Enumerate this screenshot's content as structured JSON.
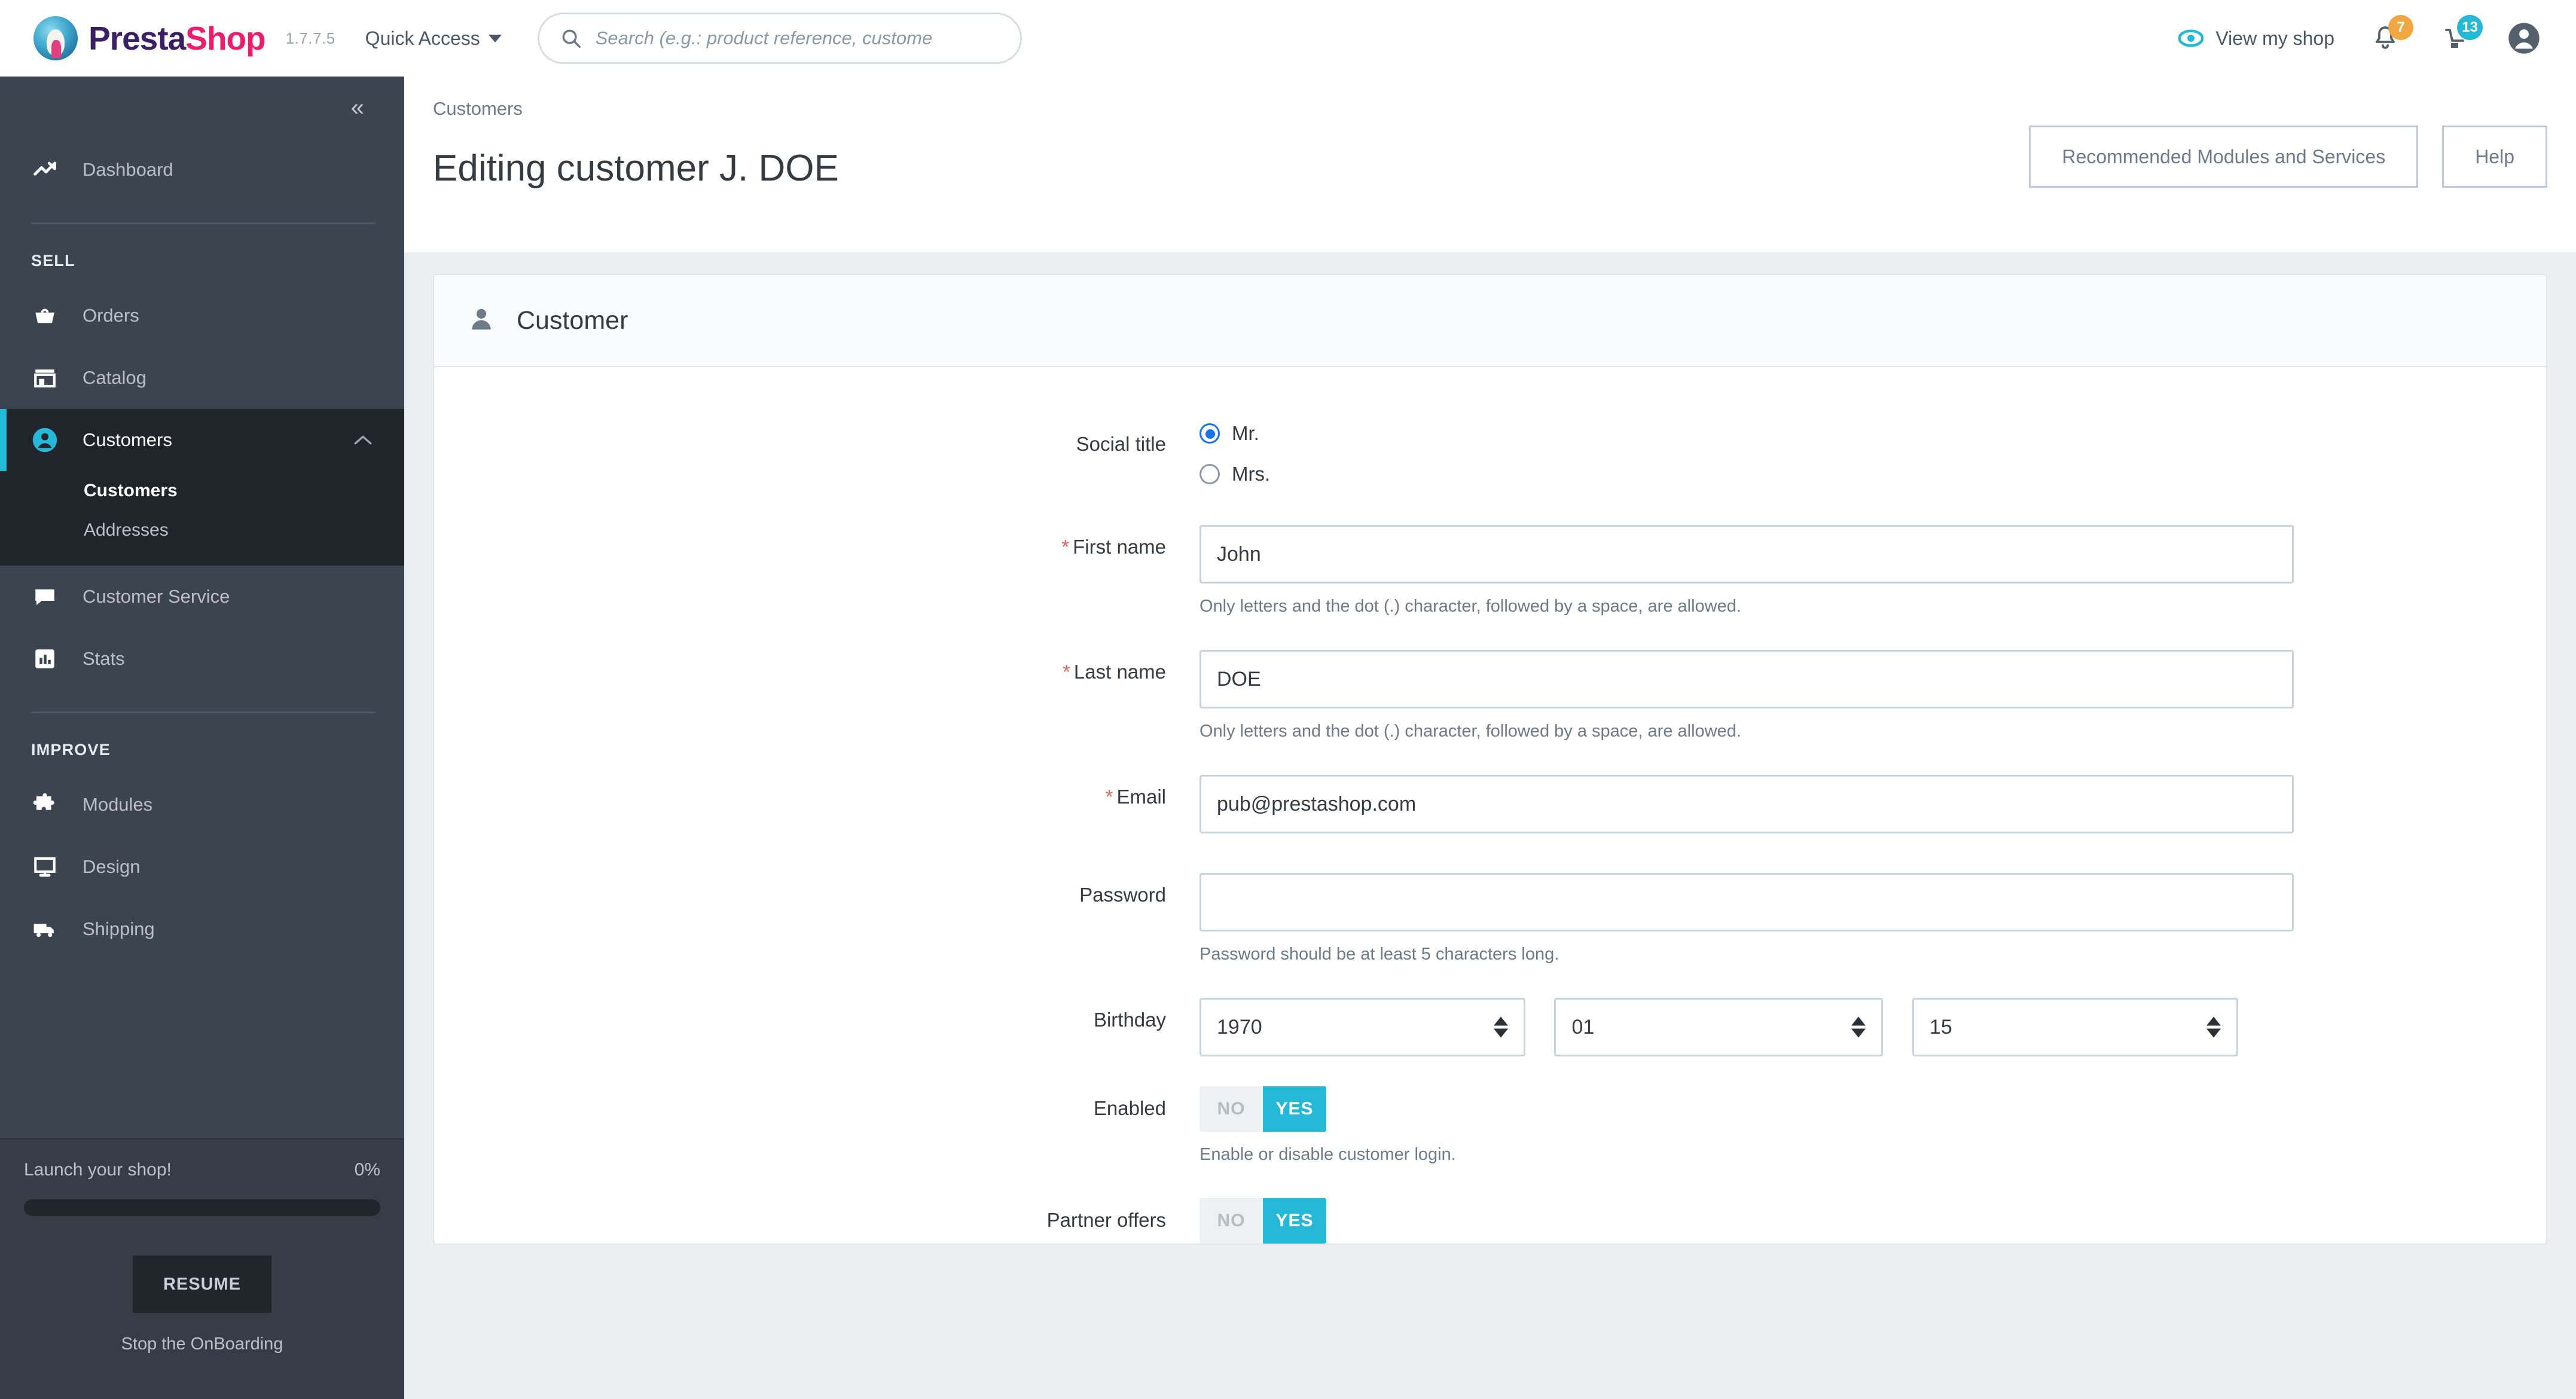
{
  "topbar": {
    "brand_presta": "Presta",
    "brand_shop": "Shop",
    "version": "1.7.7.5",
    "quick_access_label": "Quick Access",
    "search_placeholder": "Search (e.g.: product reference, custome",
    "search_value": "",
    "search_icon": "search-icon",
    "view_shop_label": "View my shop",
    "view_shop_icon": "eye-icon",
    "notifications": {
      "bell_icon": "bell-icon",
      "bell_badge": "7",
      "bell_badge_color": "#f0a741",
      "cart_icon": "cart-notification-icon",
      "cart_badge": "13",
      "cart_badge_color": "#25b9d7"
    },
    "account_icon": "user-account-icon"
  },
  "sidebar": {
    "collapse_label": "«",
    "accent_color": "#25b9d7",
    "background_color": "#3c444f",
    "active_background": "#20252b",
    "top_items": [
      {
        "label": "Dashboard",
        "icon": "trend-up-icon"
      }
    ],
    "sections": [
      {
        "title": "SELL",
        "items": [
          {
            "label": "Orders",
            "icon": "basket-icon",
            "active": false
          },
          {
            "label": "Catalog",
            "icon": "store-icon",
            "active": false
          },
          {
            "label": "Customers",
            "icon": "customer-icon",
            "active": true,
            "chevron": "chevron-up-icon",
            "children": [
              {
                "label": "Customers",
                "current": true
              },
              {
                "label": "Addresses",
                "current": false
              }
            ]
          },
          {
            "label": "Customer Service",
            "icon": "chat-icon",
            "active": false
          },
          {
            "label": "Stats",
            "icon": "bar-chart-icon",
            "active": false
          }
        ]
      },
      {
        "title": "IMPROVE",
        "items": [
          {
            "label": "Modules",
            "icon": "puzzle-icon",
            "active": false
          },
          {
            "label": "Design",
            "icon": "monitor-icon",
            "active": false
          },
          {
            "label": "Shipping",
            "icon": "truck-icon",
            "active": false
          }
        ]
      }
    ],
    "onboarding": {
      "title": "Launch your shop!",
      "percent": "0%",
      "progress_value": 0,
      "resume_label": "RESUME",
      "stop_label": "Stop the OnBoarding"
    }
  },
  "page": {
    "breadcrumb": "Customers",
    "title": "Editing customer J. DOE",
    "actions": [
      {
        "label": "Recommended Modules and Services"
      },
      {
        "label": "Help"
      }
    ]
  },
  "card": {
    "icon": "customer-icon",
    "title": "Customer",
    "fields": {
      "social_title": {
        "label": "Social title",
        "options": [
          {
            "label": "Mr.",
            "selected": true
          },
          {
            "label": "Mrs.",
            "selected": false
          }
        ]
      },
      "first_name": {
        "label": "First name",
        "required": true,
        "required_marker": "*",
        "value": "John",
        "placeholder": "",
        "helper": "Only letters and the dot (.) character, followed by a space, are allowed."
      },
      "last_name": {
        "label": "Last name",
        "required": true,
        "required_marker": "*",
        "value": "DOE",
        "placeholder": "",
        "helper": "Only letters and the dot (.) character, followed by a space, are allowed."
      },
      "email": {
        "label": "Email",
        "required": true,
        "required_marker": "*",
        "value": "pub@prestashop.com",
        "placeholder": "",
        "helper": ""
      },
      "password": {
        "label": "Password",
        "required": false,
        "value": "",
        "placeholder": "",
        "helper": "Password should be at least 5 characters long."
      },
      "birthday": {
        "label": "Birthday",
        "year": "1970",
        "month": "01",
        "day": "15"
      },
      "enabled": {
        "label": "Enabled",
        "no_label": "NO",
        "yes_label": "YES",
        "value": "YES",
        "helper": "Enable or disable customer login."
      },
      "partner_offers": {
        "label": "Partner offers",
        "no_label": "NO",
        "yes_label": "YES",
        "value": "YES",
        "helper": ""
      }
    }
  }
}
